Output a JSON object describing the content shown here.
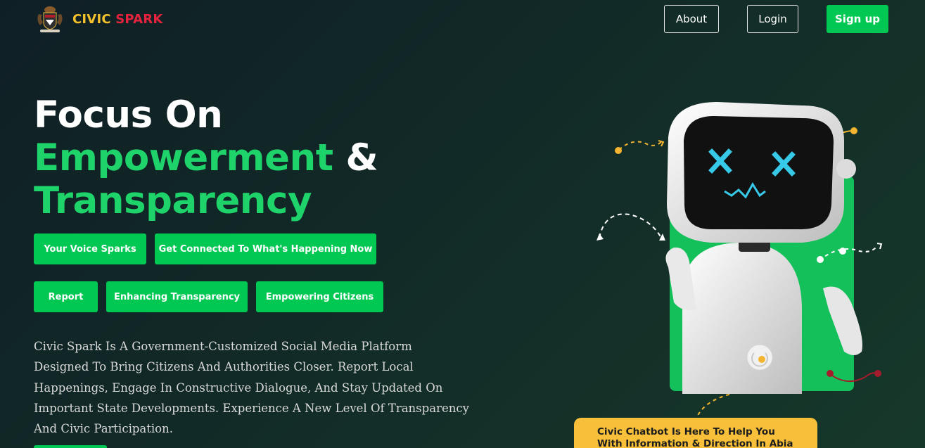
{
  "header": {
    "logo_icon": "coat-of-arms-icon",
    "brand_first": "CIVIC",
    "brand_second": "SPARK",
    "nav": {
      "about": "About",
      "login": "Login",
      "signup": "Sign up"
    }
  },
  "hero": {
    "title_line1": "Focus On",
    "title_line2_green": "Empowerment",
    "title_line2_white": "&",
    "title_line3": "Transparency",
    "pills": [
      "Your Voice Sparks",
      "Get Connected To What's Happening Now",
      "Report",
      "Enhancing Transparency",
      "Empowering Citizens"
    ],
    "description": "Civic Spark Is A Government-Customized Social Media Platform Designed To Bring Citizens And Authorities Closer. Report Local Happenings, Engage In Constructive Dialogue, And Stay Updated On Important State Developments. Experience A New Level Of Transparency And Civic Participation."
  },
  "chatbot": {
    "illustration": "robot-illustration",
    "bubble_text": "Civic Chatbot Is Here To Help You With Information & Direction In Abia State."
  },
  "colors": {
    "accent_green": "#00c853",
    "heading_green": "#1fd36b",
    "brand_yellow": "#f4c12a",
    "brand_red": "#e5233d",
    "bubble_yellow": "#f7bf3a"
  }
}
